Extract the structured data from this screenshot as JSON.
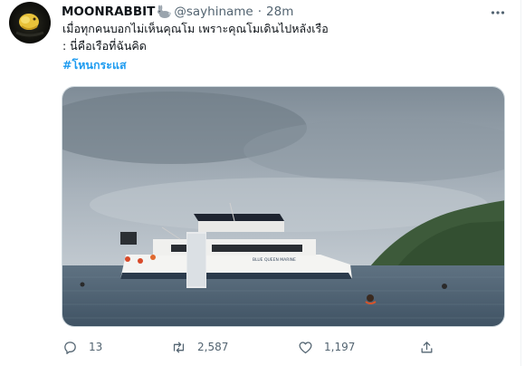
{
  "tweet": {
    "display_name": "MOONRABBIT",
    "handle": "@sayhiname",
    "separator": "·",
    "time": "28m",
    "text_line1": "เมื่อทุกคนบอกไม่เห็นคุณโม เพราะคุณโมเดินไปหลังเรือ",
    "text_line2": ": นี่คือเรือที่ฉันคิด",
    "hashtag": "#โหนกระแส"
  },
  "media": {
    "boat_label": "BLUE QUEEN MARINE"
  },
  "actions": {
    "replies": "13",
    "retweets": "2,587",
    "likes": "1,197"
  },
  "icons": {
    "avatar": "avatar-image",
    "name_emoji": "rabbit-icon",
    "more": "more-icon",
    "reply": "reply-icon",
    "retweet": "retweet-icon",
    "like": "heart-icon",
    "share": "share-icon"
  },
  "colors": {
    "accent": "#1d9bf0",
    "muted": "#536471",
    "text": "#0f1419"
  }
}
